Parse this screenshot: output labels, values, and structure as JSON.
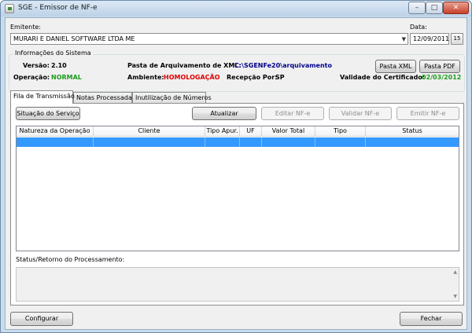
{
  "window": {
    "title": "SGE - Emissor de NF-e",
    "minimize": "–",
    "maximize": "□",
    "close": "✕"
  },
  "emitente": {
    "label": "Emitente:",
    "value": "MURARI E DANIEL SOFTWARE LTDA ME",
    "arrow": "▼"
  },
  "data": {
    "label": "Data:",
    "value": "12/09/2011",
    "cal_icon": "15"
  },
  "info": {
    "title": "Informações do Sistema",
    "versao_label": "Versão:",
    "versao_value": "2.10",
    "pasta_label": "Pasta de Arquivamento de XML:",
    "pasta_value": "C:\\SGENFe20\\arquivamento",
    "operacao_label": "Operação:",
    "operacao_value": "NORMAL",
    "ambiente_label": "Ambiente:",
    "ambiente_value": "HOMOLOGAÇÃO",
    "recepcao_label": "Recepção Por:",
    "recepcao_value": "SP",
    "validade_label": "Validade do Certificado:",
    "validade_value": "02/03/2012",
    "pasta_xml_btn": "Pasta XML",
    "pasta_pdf_btn": "Pasta PDF"
  },
  "tabs": [
    {
      "label": "Fila de Transmissão"
    },
    {
      "label": "Notas Processadas"
    },
    {
      "label": "Inutilização de Números"
    }
  ],
  "toolbar": {
    "situacao": "Situação do Serviço",
    "atualizar": "Atualizar",
    "editar": "Editar NF-e",
    "validar": "Validar NF-e",
    "emitir": "Emitir NF-e"
  },
  "grid": {
    "columns": [
      "Natureza da Operação",
      "Cliente",
      "Tipo Apur.",
      "UF",
      "Valor Total",
      "Tipo",
      "Status"
    ]
  },
  "status": {
    "label": "Status/Retorno do Processamento:",
    "up": "▲",
    "down": "▼"
  },
  "footer": {
    "configurar": "Configurar",
    "fechar": "Fechar"
  },
  "colors": {
    "green": "#1e9b1e",
    "red": "#e00000",
    "navy": "#00008b",
    "selection": "#3399ff"
  }
}
